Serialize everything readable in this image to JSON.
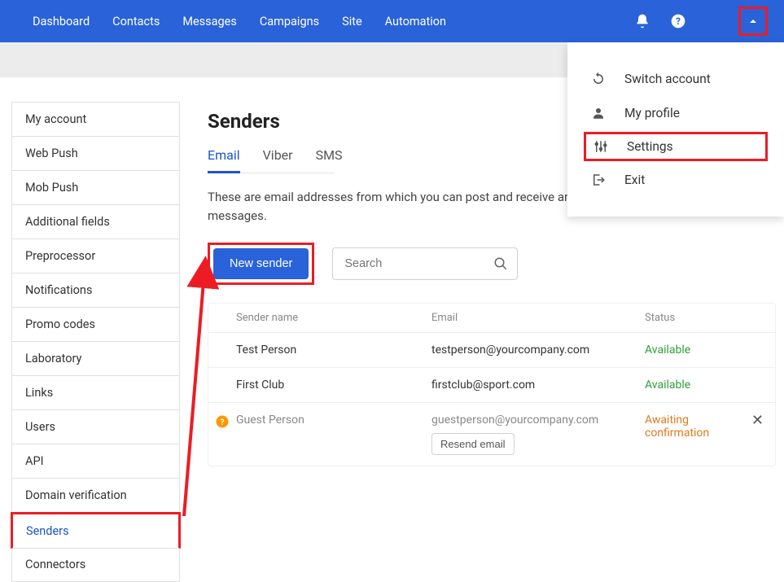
{
  "topnav": {
    "items": [
      "Dashboard",
      "Contacts",
      "Messages",
      "Campaigns",
      "Site",
      "Automation"
    ]
  },
  "dropdown": {
    "items": [
      {
        "label": "Switch account",
        "icon": "refresh-icon"
      },
      {
        "label": "My profile",
        "icon": "user-icon"
      },
      {
        "label": "Settings",
        "icon": "sliders-icon",
        "highlight": true
      },
      {
        "label": "Exit",
        "icon": "exit-icon"
      }
    ]
  },
  "sidebar": {
    "items": [
      "My account",
      "Web Push",
      "Mob Push",
      "Additional fields",
      "Preprocessor",
      "Notifications",
      "Promo codes",
      "Laboratory",
      "Links",
      "Users",
      "API",
      "Domain verification",
      "Senders",
      "Connectors"
    ],
    "active_index": 12
  },
  "page": {
    "title": "Senders",
    "tabs": [
      "Email",
      "Viber",
      "SMS"
    ],
    "active_tab": 0,
    "description": "These are email addresses from which you can post and receive answers and technical messages.",
    "new_button": "New sender",
    "search_placeholder": "Search"
  },
  "table": {
    "headers": {
      "name": "Sender name",
      "email": "Email",
      "status": "Status"
    },
    "rows": [
      {
        "name": "Test Person",
        "email": "testperson@yourcompany.com",
        "status": "Available",
        "status_class": "green"
      },
      {
        "name": "First Club",
        "email": "firstclub@sport.com",
        "status": "Available",
        "status_class": "green"
      },
      {
        "name": "Guest Person",
        "email": "guestperson@yourcompany.com",
        "status": "Awaiting confirmation",
        "status_class": "orange",
        "pending": true,
        "resend_label": "Resend email"
      }
    ]
  }
}
